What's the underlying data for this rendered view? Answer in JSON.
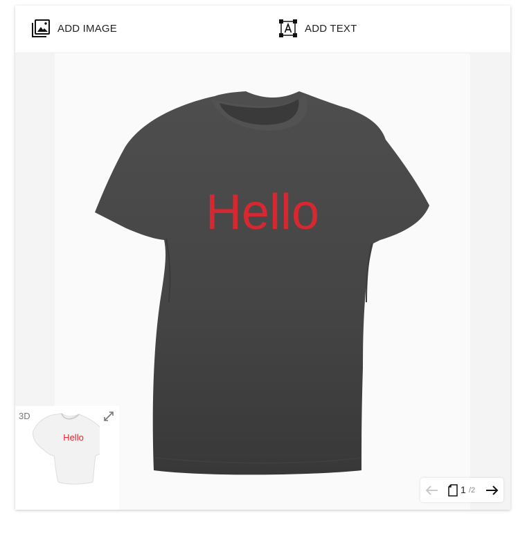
{
  "toolbar": {
    "add_image_label": "ADD IMAGE",
    "add_text_label": "ADD TEXT",
    "add_image_icon": "add-image-icon",
    "add_text_icon": "add-text-icon"
  },
  "canvas": {
    "product": "t-shirt",
    "shirt_color": "#474747",
    "design_text": "Hello",
    "design_text_color": "#e3262e"
  },
  "preview": {
    "tag": "3D",
    "design_text": "Hello",
    "shirt_color": "#f2f2f2",
    "expand_icon": "expand-icon"
  },
  "pager": {
    "current": "1",
    "total_label": "/2",
    "prev_icon": "arrow-left-icon",
    "next_icon": "arrow-right-icon",
    "page_icon": "page-icon"
  }
}
